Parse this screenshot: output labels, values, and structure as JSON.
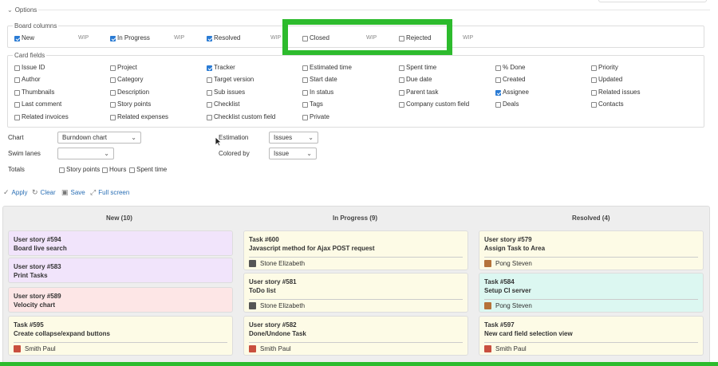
{
  "options": {
    "title": "Options",
    "chevron": "chevron-down-icon"
  },
  "board_columns": {
    "title": "Board columns",
    "items": [
      {
        "label": "New",
        "checked": true,
        "wip": "WIP"
      },
      {
        "label": "In Progress",
        "checked": true,
        "wip": "WIP"
      },
      {
        "label": "Resolved",
        "checked": true,
        "wip": "WIP"
      },
      {
        "label": "Closed",
        "checked": false,
        "wip": "WIP"
      },
      {
        "label": "Rejected",
        "checked": false,
        "wip": "WIP"
      }
    ]
  },
  "card_fields": {
    "title": "Card fields",
    "items": [
      {
        "label": "Issue ID",
        "checked": false
      },
      {
        "label": "Project",
        "checked": false
      },
      {
        "label": "Tracker",
        "checked": true
      },
      {
        "label": "Estimated time",
        "checked": false
      },
      {
        "label": "Spent time",
        "checked": false
      },
      {
        "label": "% Done",
        "checked": false
      },
      {
        "label": "Priority",
        "checked": false
      },
      {
        "label": "Author",
        "checked": false
      },
      {
        "label": "Category",
        "checked": false
      },
      {
        "label": "Target version",
        "checked": false
      },
      {
        "label": "Start date",
        "checked": false
      },
      {
        "label": "Due date",
        "checked": false
      },
      {
        "label": "Created",
        "checked": false
      },
      {
        "label": "Updated",
        "checked": false
      },
      {
        "label": "Thumbnails",
        "checked": false
      },
      {
        "label": "Description",
        "checked": false
      },
      {
        "label": "Sub issues",
        "checked": false
      },
      {
        "label": "In status",
        "checked": false
      },
      {
        "label": "Parent task",
        "checked": false
      },
      {
        "label": "Assignee",
        "checked": true
      },
      {
        "label": "Related issues",
        "checked": false
      },
      {
        "label": "Last comment",
        "checked": false
      },
      {
        "label": "Story points",
        "checked": false
      },
      {
        "label": "Checklist",
        "checked": false
      },
      {
        "label": "Tags",
        "checked": false
      },
      {
        "label": "Company custom field",
        "checked": false
      },
      {
        "label": "Deals",
        "checked": false
      },
      {
        "label": "Contacts",
        "checked": false
      },
      {
        "label": "Related invoices",
        "checked": false
      },
      {
        "label": "Related expenses",
        "checked": false
      },
      {
        "label": "Checklist custom field",
        "checked": false
      },
      {
        "label": "Private",
        "checked": false
      }
    ]
  },
  "settings": {
    "chart_label": "Chart",
    "chart_value": "Burndown chart",
    "estimation_label": "Estimation",
    "estimation_value": "Issues",
    "swimlanes_label": "Swim lanes",
    "swimlanes_value": "",
    "coloredby_label": "Colored by",
    "coloredby_value": "Issue",
    "totals_label": "Totals",
    "totals": [
      {
        "label": "Story points",
        "checked": false
      },
      {
        "label": "Hours",
        "checked": false
      },
      {
        "label": "Spent time",
        "checked": false
      }
    ]
  },
  "actions": {
    "apply": "Apply",
    "clear": "Clear",
    "save": "Save",
    "fullscreen": "Full screen"
  },
  "board": {
    "columns": [
      {
        "title": "New (10)",
        "cards": [
          {
            "id": "User story #594",
            "subject": "Board live search",
            "color": "#f1e4fb"
          },
          {
            "id": "User story #583",
            "subject": "Print Tasks",
            "color": "#f1e4fb"
          },
          {
            "id": "User story #589",
            "subject": "Velocity chart",
            "color": "#fde6e6"
          },
          {
            "id": "Task #595",
            "subject": "Create collapse/expand buttons",
            "color": "#fdfbe6",
            "assignee": "Smith Paul",
            "avatar_color": "#c94f3e"
          }
        ]
      },
      {
        "title": "In Progress (9)",
        "cards": [
          {
            "id": "Task #600",
            "subject": "Javascript method for Ajax POST request",
            "color": "#fdfbe6",
            "assignee": "Stone Elizabeth",
            "avatar_color": "#555555"
          },
          {
            "id": "User story #581",
            "subject": "ToDo list",
            "color": "#fdfbe6",
            "assignee": "Stone Elizabeth",
            "avatar_color": "#555555"
          },
          {
            "id": "User story #582",
            "subject": "Done/Undone Task",
            "color": "#fdfbe6",
            "assignee": "Smith Paul",
            "avatar_color": "#c94f3e"
          }
        ]
      },
      {
        "title": "Resolved (4)",
        "cards": [
          {
            "id": "User story #579",
            "subject": "Assign Task to Area",
            "color": "#fdfbe6",
            "assignee": "Pong Steven",
            "avatar_color": "#b5733a"
          },
          {
            "id": "Task #584",
            "subject": "Setup CI server",
            "color": "#dcf7f1",
            "assignee": "Pong Steven",
            "avatar_color": "#b5733a"
          },
          {
            "id": "Task #597",
            "subject": "New card field selection view",
            "color": "#fdfbe6",
            "assignee": "Smith Paul",
            "avatar_color": "#c94f3e"
          }
        ]
      }
    ]
  }
}
